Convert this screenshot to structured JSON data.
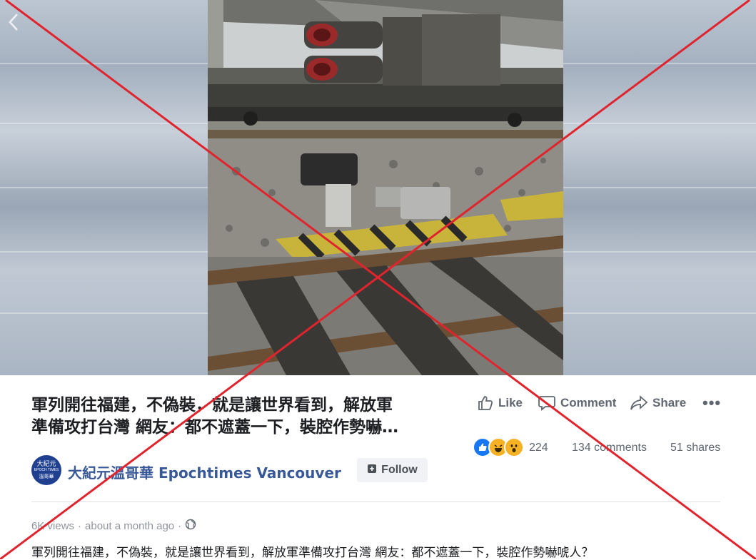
{
  "post": {
    "headline_line1": "軍列開往福建，不偽裝，就是讓世界看到，解放軍",
    "headline_line2": "準備攻打台灣 網友：都不遮蓋一下，裝腔作勢嚇…",
    "description": "軍列開往福建，不偽裝，就是讓世界看到，解放軍準備攻打台灣 網友：都不遮蓋一下，裝腔作勢嚇唬人？"
  },
  "actions": {
    "like_label": "Like",
    "comment_label": "Comment",
    "share_label": "Share",
    "more_label": "•••"
  },
  "stats": {
    "reactions": "224",
    "comments": "134 comments",
    "shares": "51 shares"
  },
  "page": {
    "name": "大紀元溫哥華 Epochtimes Vancouver",
    "avatar_text_top": "大紀元",
    "avatar_text_mid": "EPOCH TIMES",
    "avatar_text_bottom": "溫哥華",
    "follow_label": "Follow"
  },
  "meta": {
    "views": "6K views",
    "separator": "·",
    "time": "about a month ago"
  },
  "icons": {
    "back": "chevron-left-icon",
    "like": "thumbs-up-icon",
    "comment": "speech-bubble-icon",
    "share": "share-arrow-icon",
    "globe": "globe-icon",
    "follow": "follow-plus-icon"
  },
  "colors": {
    "page_link": "#385898",
    "like_reaction": "#1877f2",
    "haha_reaction": "#f7b125",
    "cross_mark": "#e0242e"
  }
}
